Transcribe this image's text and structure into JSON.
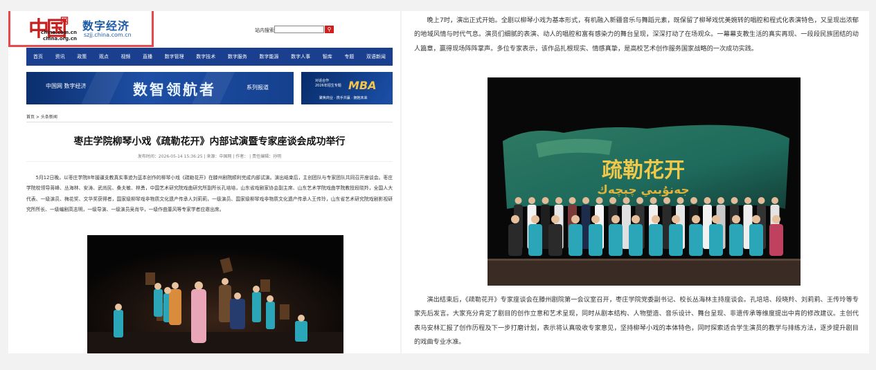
{
  "header": {
    "logo_mark": "中国",
    "logo_wang": "网",
    "logo_domain_1": "china.com.cn",
    "logo_domain_2": "china.org.cn",
    "site_name": "数字经济",
    "site_url": "szjj.china.com.cn",
    "search_label": "站内搜索",
    "search_placeholder": "",
    "search_icon": "search-icon"
  },
  "nav": [
    "首页",
    "资讯",
    "政策",
    "观点",
    "视频",
    "直播",
    "数字管理",
    "数字技术",
    "数字服务",
    "数字能源",
    "数字人事",
    "智库",
    "专题",
    "双语新闻"
  ],
  "banner": {
    "logo": "中国网 数字经济",
    "title": "数智领航者",
    "subtitle": "系列报道",
    "side_line1": "对话合作",
    "side_line2": "2026年招生专题",
    "side_mba": "MBA",
    "side_caption": "聚焦商业 · 携手共赢 · 拥抱未来"
  },
  "breadcrumb": "首页 > 头条新闻",
  "article": {
    "title": "枣庄学院柳琴小戏《疏勒花开》内部试演暨专家座谈会成功举行",
    "meta": "发布时间：2026-05-14 15:36:25 | 来源：中国网 | 作者： | 责任编辑：孙明",
    "para1": "5月12日晚，以枣庄学院8年援疆支教真实事迹为蓝本创作的柳琴小戏《疏勒花开》在滕州剧院顺利完成内部试演。演出结束后，主创团队与专家团队共同召开座谈会。枣庄学院校领导蒋峰、丛海林、安涛、武尚民、桑夫敏、林勇，中国艺术研究院戏曲研究所副所长孔培培，山东省戏剧家协会副主席、山东艺术学院戏曲学院教授段晓羚，全国人大代表、一级演员、梅花奖、文华奖获得者，国家级柳琴戏非物质文化遗产传承人刘莉莉，一级演员、国家级柳琴戏非物质文化遗产传承人王传玲，山东省艺术研究院戏剧影视研究所所长、一级编剧高志明，一级导演、一级演员吴肖华，一级作曲董风等专家学者应邀出席。",
    "para2": "晚上7时，演出正式开始。全剧以柳琴小戏为基本形式，有机融入新疆音乐与舞蹈元素，既保留了柳琴戏优美婉转的唱腔和程式化表演特色，又呈现出浓郁的地域风情与时代气息。演员们细腻的表演、动人的唱腔和富有感染力的舞台呈现，深深打动了在场观众。一幕幕支教生活的真实再现、一段段民族团结的动人篇章，赢得现场阵阵掌声。多位专家表示，该作品扎根现实、情感真挚，是高校艺术创作服务国家战略的一次成功实践。",
    "para3": "演出结束后，《疏勒花开》专家座谈会在滕州剧院第一会议室召开，枣庄学院党委副书记、校长丛海林主持座谈会。孔培培、段晓羚、刘莉莉、王传玲等专家先后发言。大家充分肯定了剧目的创作立意和艺术呈现，同时从剧本结构、人物塑造、音乐设计、舞台呈现、非遗传承等维度提出中肯的修改建议。主创代表马安林汇报了创作历程及下一步打磨计划，表示将认真吸收专家意见，坚持柳琴小戏的本体特色，同时探索适合学生演员的教学与排练方法，逐步提升剧目的戏曲专业水准。",
    "stage_title": "疏勒花开",
    "stage_uyghur": "جەنۇبىي چېچەك"
  },
  "colors": {
    "nav_bg": "#1a3f8e",
    "brand_red": "#c81f1f",
    "brand_blue": "#1b5aa8",
    "highlight_border": "#e8474c",
    "costume_teal": "#2aa6b8",
    "backdrop_green": "#1e6a5c"
  }
}
